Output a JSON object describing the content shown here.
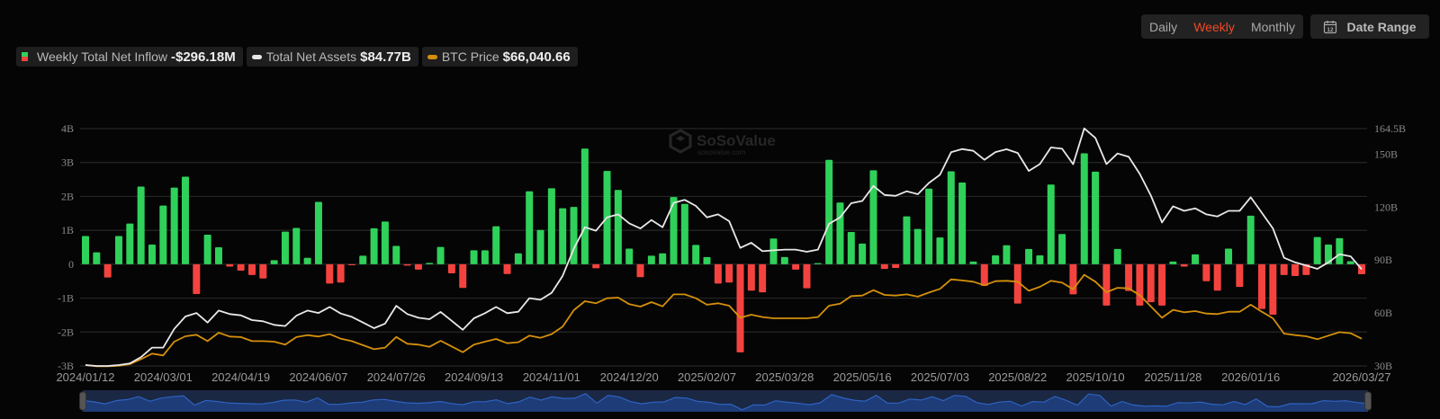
{
  "controls": {
    "periods": [
      "Daily",
      "Weekly",
      "Monthly"
    ],
    "active_period": "Weekly",
    "date_range_label": "Date Range",
    "calendar_day": "12"
  },
  "legend": [
    {
      "label": "Weekly Total Net Inflow",
      "value": "-$296.18M",
      "colors": [
        "#2fd15a",
        "#f4433f"
      ]
    },
    {
      "label": "Total Net Assets",
      "value": "$84.77B",
      "color": "#e8e8e8"
    },
    {
      "label": "BTC Price",
      "value": "$66,040.66",
      "color": "#d4900a"
    }
  ],
  "watermark": {
    "brand": "SoSoValue",
    "site": "sosovalue.com"
  },
  "chart_data": {
    "type": "bar+line",
    "frequency": "weekly",
    "x_ticks": [
      "2024/01/12",
      "2024/03/01",
      "2024/04/19",
      "2024/06/07",
      "2024/07/26",
      "2024/09/13",
      "2024/11/01",
      "2024/12/20",
      "2025/02/07",
      "2025/03/28",
      "2025/05/16",
      "2025/07/03",
      "2025/08/22",
      "2025/10/10",
      "2025/11/28",
      "2026/01/16",
      "2026/03/27"
    ],
    "y_left": {
      "ticks": [
        "4B",
        "3B",
        "2B",
        "1B",
        "0",
        "-1B",
        "-2B",
        "-3B"
      ],
      "tick_values": [
        4,
        3,
        2,
        1,
        0,
        -1,
        -2,
        -3
      ],
      "range": [
        -3,
        4
      ],
      "unit": "USD billions"
    },
    "y_right": {
      "ticks": [
        "164.5B",
        "150B",
        "120B",
        "90B",
        "60B",
        "30B"
      ],
      "tick_values": [
        164.5,
        150,
        120,
        90,
        60,
        30
      ],
      "range": [
        30,
        164.5
      ],
      "unit": "USD billions"
    },
    "grid": true,
    "colors": {
      "positive": "#2fd15a",
      "negative": "#f4433f",
      "net_assets": "#e8e8e8",
      "btc": "#d4900a",
      "grid": "#262626"
    },
    "series": [
      {
        "name": "Weekly Total Net Inflow",
        "type": "bar",
        "unit": "USD billions",
        "values": [
          0.83,
          0.35,
          -0.39,
          0.83,
          1.2,
          2.29,
          0.58,
          1.73,
          2.26,
          2.58,
          -0.88,
          0.87,
          0.5,
          -0.07,
          -0.19,
          -0.32,
          -0.42,
          0.12,
          0.96,
          1.07,
          0.19,
          1.84,
          -0.57,
          -0.54,
          -0.03,
          0.25,
          1.06,
          1.26,
          0.54,
          -0.04,
          -0.16,
          0.04,
          0.51,
          -0.27,
          -0.7,
          0.41,
          0.41,
          1.12,
          -0.29,
          0.32,
          2.15,
          1.01,
          2.24,
          1.65,
          1.69,
          3.41,
          -0.12,
          2.75,
          2.19,
          0.46,
          -0.38,
          0.25,
          0.32,
          1.98,
          1.78,
          0.57,
          0.21,
          -0.57,
          -0.54,
          -2.6,
          -0.78,
          -0.83,
          0.76,
          0.21,
          -0.16,
          -0.71,
          0.03,
          3.08,
          1.82,
          0.95,
          0.61,
          2.77,
          -0.14,
          -0.11,
          1.41,
          1.04,
          2.23,
          0.79,
          2.74,
          2.41,
          0.08,
          -0.64,
          0.26,
          0.56,
          -1.16,
          0.45,
          0.26,
          2.35,
          0.89,
          -0.89,
          3.27,
          2.73,
          -1.22,
          0.45,
          -0.79,
          -1.22,
          -1.12,
          -1.22,
          0.08,
          -0.07,
          0.29,
          -0.5,
          -0.78,
          0.46,
          -0.67,
          1.43,
          -1.32,
          -1.49,
          -0.32,
          -0.35,
          -0.32,
          0.8,
          0.58,
          0.77,
          0.09,
          -0.296
        ]
      },
      {
        "name": "Total Net Assets",
        "type": "line",
        "axis": "right",
        "unit": "USD billions",
        "values": [
          30.5,
          30,
          30,
          30.5,
          31.5,
          35,
          40.4,
          40.4,
          51,
          58,
          60,
          54.6,
          61.4,
          59.4,
          58.7,
          56,
          55.3,
          53.3,
          52.6,
          58.5,
          61.4,
          60,
          63.4,
          59.7,
          57.8,
          54.6,
          51.4,
          54,
          64.1,
          59.4,
          57.3,
          56.5,
          60.6,
          55.6,
          50.5,
          57,
          59.9,
          63.4,
          59.9,
          60.7,
          68.4,
          67.5,
          71.4,
          81.1,
          96.4,
          108.6,
          106.6,
          114.2,
          115.9,
          110.8,
          107.9,
          112.7,
          108.6,
          122.4,
          124.1,
          120.7,
          114.2,
          115.9,
          112,
          96.9,
          99.8,
          95,
          95.5,
          95.9,
          95.9,
          94.7,
          95.9,
          110.5,
          114.2,
          122.2,
          123.5,
          132,
          126.9,
          126.4,
          129,
          127.3,
          133.7,
          138.3,
          151.1,
          152.9,
          151.9,
          146.8,
          151.2,
          152.8,
          150.7,
          140.5,
          144.4,
          153.8,
          153.1,
          144.3,
          164.6,
          159.2,
          144.4,
          150.4,
          148.5,
          138.8,
          126.6,
          111.3,
          120.5,
          117.9,
          119.3,
          115.9,
          114.7,
          117.9,
          117.9,
          125.6,
          116.8,
          107.9,
          91.3,
          88.7,
          86.9,
          85,
          88.7,
          93.3,
          92.1,
          84.77
        ]
      },
      {
        "name": "BTC Price",
        "type": "line",
        "axis": "hidden",
        "unit": "USD",
        "values": [
          42900,
          41800,
          41800,
          42300,
          43700,
          48100,
          52900,
          51300,
          63400,
          68100,
          69500,
          63900,
          71300,
          67900,
          67400,
          63900,
          63900,
          63400,
          60800,
          67400,
          69200,
          67900,
          70000,
          66000,
          63900,
          60300,
          56800,
          58200,
          67500,
          61600,
          60800,
          58900,
          64200,
          59200,
          54200,
          60800,
          63400,
          65800,
          62100,
          62900,
          68700,
          66800,
          70000,
          76600,
          91000,
          98900,
          97100,
          101500,
          102100,
          96300,
          94200,
          98100,
          94400,
          104900,
          104900,
          101500,
          95800,
          97100,
          95000,
          84400,
          87100,
          85000,
          83900,
          83900,
          83900,
          83900,
          85000,
          95000,
          96800,
          103400,
          103900,
          108600,
          104400,
          103900,
          104900,
          102900,
          106500,
          109700,
          118100,
          117100,
          116000,
          112900,
          116500,
          116800,
          116000,
          108100,
          111500,
          116800,
          115200,
          109400,
          122100,
          116000,
          106800,
          110700,
          110200,
          104200,
          94400,
          84400,
          91300,
          89200,
          90200,
          88100,
          87600,
          89700,
          89700,
          95800,
          89700,
          83900,
          70500,
          69200,
          68100,
          65500,
          68700,
          71800,
          70800,
          66040.66
        ]
      }
    ]
  }
}
